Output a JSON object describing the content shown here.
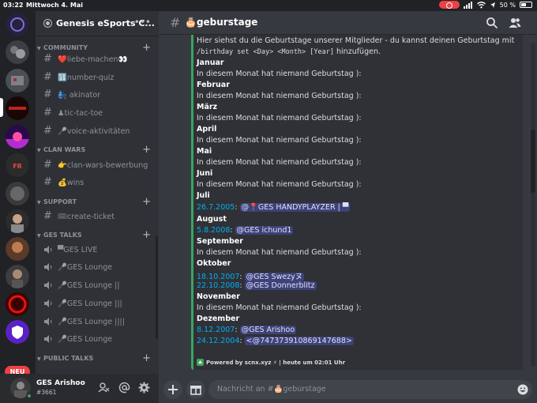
{
  "status_bar": {
    "time": "03:22",
    "date": "Mittwoch 4. Mai",
    "battery": "50 %"
  },
  "server_rail": {
    "new_badge": "NEU"
  },
  "guild": {
    "name": "Genesis eSports C...",
    "menu": "•••"
  },
  "categories": [
    {
      "label": "COMMUNITY"
    },
    {
      "label": "CLAN WARS"
    },
    {
      "label": "SUPPORT"
    },
    {
      "label": "GES TALKS"
    },
    {
      "label": "PUBLIC TALKS"
    }
  ],
  "channels": [
    {
      "label": "❤️liebe-machen👀"
    },
    {
      "label": "🔢number-quiz"
    },
    {
      "label": "🧞‍♀️ akinator"
    },
    {
      "label": "♟tic-tac-toe"
    },
    {
      "label": "🎤voice-aktivitäten"
    },
    {
      "label": "👉clan-wars-bewerbung"
    },
    {
      "label": "💰wins"
    },
    {
      "label": "🎟create-ticket"
    }
  ],
  "voice_channels": [
    {
      "label": "▀GES LIVE"
    },
    {
      "label": "🎤GES Lounge"
    },
    {
      "label": "🎤GES Lounge ||"
    },
    {
      "label": "🎤GES Lounge |||"
    },
    {
      "label": "🎤GES Lounge ||||"
    },
    {
      "label": "🎤GES Lounge"
    }
  ],
  "user": {
    "name": "GES Arishoo",
    "tag": "#3661"
  },
  "chat": {
    "channel_name": "🎂geburstage",
    "intro_text": "Hier siehst du die Geburtstage unserer Mitglieder - du kannst deinen Geburtstag mit ",
    "intro_cmd1": "/birthday set <Day> <Month> [Year]",
    "intro_end": " hinzufügen.",
    "no_birthday": "In diesem Monat hat niemand Geburtstag ):",
    "months": {
      "jan": "Januar",
      "feb": "Februar",
      "mar": "März",
      "apr": "April",
      "may": "Mai",
      "jun": "Juni",
      "jul": "Juli",
      "aug": "August",
      "sep": "September",
      "oct": "Oktober",
      "nov": "November",
      "dec": "Dezember"
    },
    "entries": {
      "jul1_date": "26.7.2005",
      "jul1_user": "@📍GES HANDYPLAYZER | ▀",
      "aug1_date": "5.8.2008",
      "aug1_user": "@GES ichund1",
      "oct1_date": "18.10.2007",
      "oct1_user": "@GES Swezyヌ",
      "oct2_date": "22.10.2008",
      "oct2_user": "@GES Donnerblitz",
      "dec1_date": "8.12.2007",
      "dec1_user": "@GES Arishoo",
      "dec2_date": "24.12.2004",
      "dec2_user": "<@747373910869147688>"
    },
    "footer": "Powered by scnx.xyz ⚡ | heute um 02:01 Uhr",
    "composer_placeholder": "Nachricht an #🎂geburstage"
  },
  "colors": {
    "accent_green": "#3ba55d",
    "link": "#00aff4",
    "notification_red": "#ed4245"
  }
}
